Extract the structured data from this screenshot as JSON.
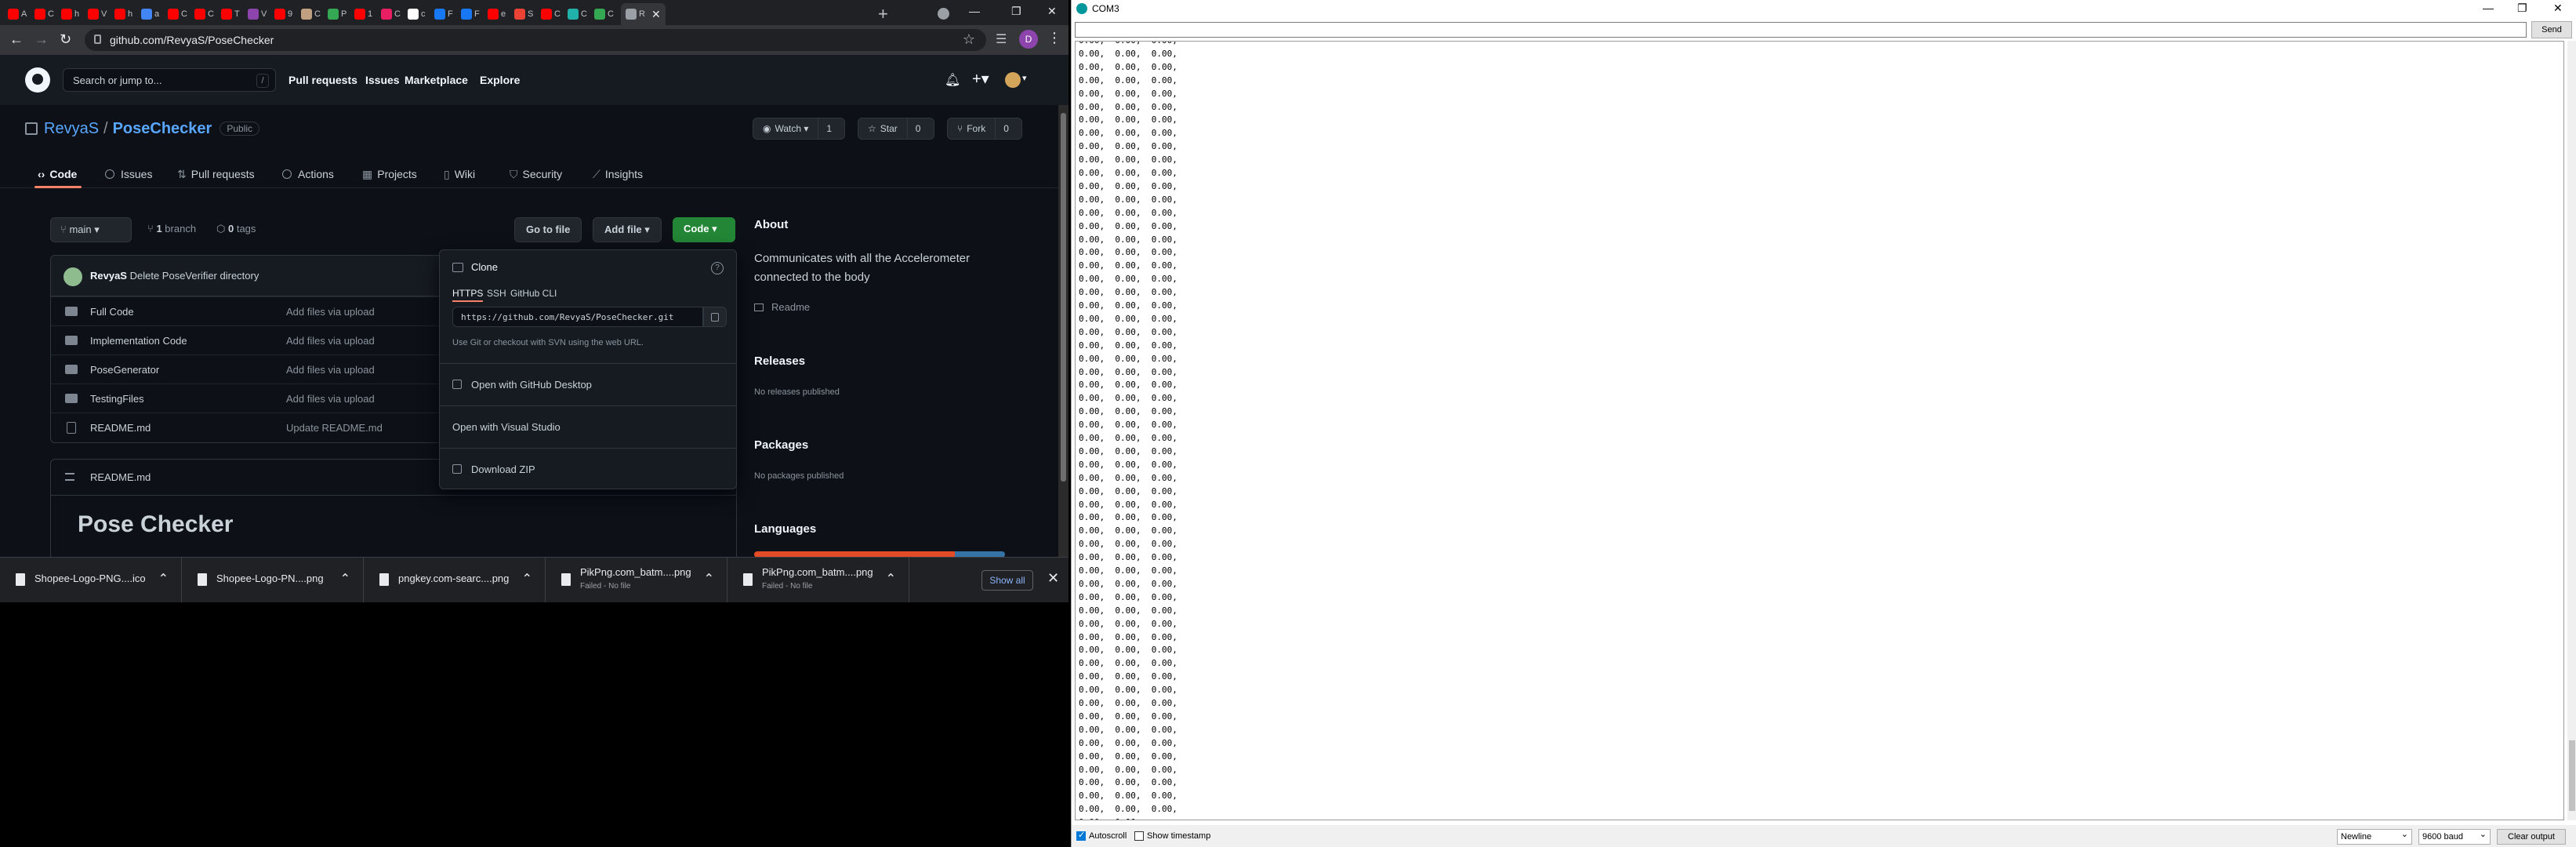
{
  "chrome": {
    "tabs": [
      {
        "label": "A",
        "color": "#ff0000"
      },
      {
        "label": "C",
        "color": "#ff0000"
      },
      {
        "label": "h",
        "color": "#ff0000"
      },
      {
        "label": "V",
        "color": "#ff0000"
      },
      {
        "label": "h",
        "color": "#ff0000"
      },
      {
        "label": "a",
        "color": "#4285f4"
      },
      {
        "label": "C",
        "color": "#ff0000"
      },
      {
        "label": "C",
        "color": "#ff0000"
      },
      {
        "label": "T",
        "color": "#ff0000"
      },
      {
        "label": "V",
        "color": "#8e44ad"
      },
      {
        "label": "9",
        "color": "#ff0000"
      },
      {
        "label": "C",
        "color": "#c0a080"
      },
      {
        "label": "P",
        "color": "#34a853"
      },
      {
        "label": "1",
        "color": "#ff0000"
      },
      {
        "label": "C",
        "color": "#e91e63"
      },
      {
        "label": "c",
        "color": "#ffffff"
      },
      {
        "label": "F",
        "color": "#1877f2"
      },
      {
        "label": "F",
        "color": "#1877f2"
      },
      {
        "label": "e",
        "color": "#ff0000"
      },
      {
        "label": "S",
        "color": "#ea4335"
      },
      {
        "label": "C",
        "color": "#ff0000"
      },
      {
        "label": "C",
        "color": "#20b2aa"
      },
      {
        "label": "C",
        "color": "#34a853"
      },
      {
        "label": "R",
        "color": "#9aa0a6"
      }
    ],
    "url": "github.com/RevyaS/PoseChecker",
    "profile_letter": "D"
  },
  "github": {
    "search_placeholder": "Search or jump to...",
    "search_key": "/",
    "nav": [
      "Pull requests",
      "Issues",
      "Marketplace",
      "Explore"
    ],
    "owner": "RevyaS",
    "repo": "PoseChecker",
    "visibility": "Public",
    "watch_label": "Watch",
    "watch_count": "1",
    "star_label": "Star",
    "star_count": "0",
    "fork_label": "Fork",
    "fork_count": "0",
    "tabs": [
      "Code",
      "Issues",
      "Pull requests",
      "Actions",
      "Projects",
      "Wiki",
      "Security",
      "Insights"
    ],
    "branch": "main",
    "branches_count": "1",
    "branches_label": "branch",
    "tags_count": "0",
    "tags_label": "tags",
    "go_to_file": "Go to file",
    "add_file": "Add file",
    "code_button": "Code",
    "commit_author": "RevyaS",
    "commit_message": "Delete PoseVerifier directory",
    "files": [
      {
        "name": "Full Code",
        "commit": "Add files via upload",
        "type": "dir"
      },
      {
        "name": "Implementation Code",
        "commit": "Add files via upload",
        "type": "dir"
      },
      {
        "name": "PoseGenerator",
        "commit": "Add files via upload",
        "type": "dir"
      },
      {
        "name": "TestingFiles",
        "commit": "Add files via upload",
        "type": "dir"
      },
      {
        "name": "README.md",
        "commit": "Update README.md",
        "type": "file"
      }
    ],
    "readme_file": "README.md",
    "readme_title": "Pose Checker",
    "about": {
      "heading": "About",
      "description": "Communicates with all the Accelerometer connected to the body",
      "readme_link": "Readme",
      "releases_heading": "Releases",
      "releases_text": "No releases published",
      "packages_heading": "Packages",
      "packages_text": "No packages published",
      "languages_heading": "Languages"
    },
    "clone": {
      "title": "Clone",
      "help": "?",
      "tabs": [
        "HTTPS",
        "SSH",
        "GitHub CLI"
      ],
      "url": "https://github.com/RevyaS/PoseChecker.git",
      "help_text": "Use Git or checkout with SVN using the web URL.",
      "actions": [
        "Open with GitHub Desktop",
        "Open with Visual Studio",
        "Download ZIP"
      ]
    }
  },
  "downloads": {
    "items": [
      {
        "name": "Shopee-Logo-PNG....ico",
        "status": ""
      },
      {
        "name": "Shopee-Logo-PN....png",
        "status": ""
      },
      {
        "name": "pngkey.com-searc....png",
        "status": ""
      },
      {
        "name": "PikPng.com_batm....png",
        "status": "Failed - No file"
      },
      {
        "name": "PikPng.com_batm....png",
        "status": "Failed - No file"
      }
    ],
    "show_all": "Show all"
  },
  "serial": {
    "title": "COM3",
    "send": "Send",
    "line_text": "0.00,  0.00,  0.00,",
    "last_line": "0.00,  0.00,",
    "autoscroll": "Autoscroll",
    "show_timestamp": "Show timestamp",
    "line_ending": "Newline",
    "baud": "9600 baud",
    "clear": "Clear output"
  },
  "colors": {
    "gh_bg": "#0d1117",
    "gh_link": "#58a6ff",
    "gh_green": "#238636",
    "tab_underline": "#f78166",
    "lang_red": "#e34c26",
    "lang_blue": "#3572a5"
  }
}
